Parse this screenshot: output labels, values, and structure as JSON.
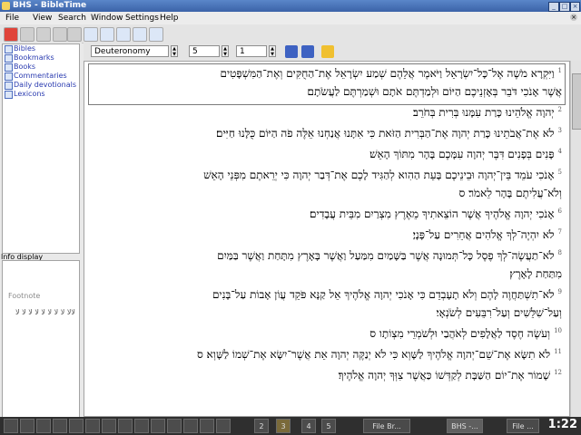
{
  "window": {
    "title": "BHS - BibleTime"
  },
  "menu": [
    "File",
    "View",
    "Search",
    "Window",
    "Settings",
    "Help"
  ],
  "modules": [
    "Bibles",
    "Bookmarks",
    "Books",
    "Commentaries",
    "Daily devotionals",
    "Lexicons"
  ],
  "info": {
    "heading": "Info display",
    "footnote": "Footnote"
  },
  "reader": {
    "book": "Deuteronomy",
    "chapter": "5",
    "verse": "1"
  },
  "verses": [
    {
      "n": "1",
      "lines": [
        "וַיִּקְרָא מֹשֶׁה אֶל־כָּל־יִשְׂרָאֵל וַיֹּאמֶר אֲלֵהֶם שְׁמַע יִשְׂרָאֵל אֶת־הַחֻקִּים וְאֶת־הַמִּשְׁפָּטִים",
        "אֲשֶׁר אָנֹכִי דֹּבֵר בְּאָזְנֵיכֶם הַיּוֹם וּלְמַדְתֶּם אֹתָם וּשְׁמַרְתֶּם לַעֲשֹׂתָם׃"
      ]
    },
    {
      "n": "2",
      "lines": [
        "יְהוָה אֱלֹהֵינוּ כָּרַת עִמָּנוּ בְּרִית בְּחֹרֵב׃"
      ]
    },
    {
      "n": "3",
      "lines": [
        "לֹא אֶת־אֲבֹתֵינוּ כָּרַת יְהוָה אֶת־הַבְּרִית הַזֹּאת כִּי אִתָּנוּ אֲנַחְנוּ אֵלֶּה פֹה הַיּוֹם כֻּלָּנוּ חַיִּים׃"
      ]
    },
    {
      "n": "4",
      "lines": [
        "פָּנִים בְּפָנִים דִּבֶּר יְהוָה עִמָּכֶם בָּהָר מִתּוֹךְ הָאֵשׁ׃"
      ]
    },
    {
      "n": "5",
      "lines": [
        "אָנֹכִי עֹמֵד בֵּין־יְהוָה וּבֵינֵיכֶם בָּעֵת הַהִוא לְהַגִּיד לָכֶם אֶת־דְּבַר יְהוָה כִּי יְרֵאתֶם מִפְּנֵי הָאֵשׁ",
        "וְלֹא־עֲלִיתֶם בָּהָר לֵאמֹר׃ ס"
      ]
    },
    {
      "n": "6",
      "lines": [
        "אָנֹכִי יְהוָה אֱלֹהֶיךָ אֲשֶׁר הוֹצֵאתִיךָ מֵאֶרֶץ מִצְרַיִם מִבֵּית עֲבָדִים׃"
      ]
    },
    {
      "n": "7",
      "lines": [
        "לֹא יִהְיֶה־לְךָ אֱלֹהִים אֲחֵרִים עַל־פָּנָיַ׃"
      ]
    },
    {
      "n": "8",
      "lines": [
        "לֹא־תַעֲשֶׂה־לְךָ פֶסֶל כָּל־תְּמוּנָה אֲשֶׁר בַּשָּׁמַיִם מִמַּעַל וַאֲשֶׁר בָּאָרֶץ מִתָּחַת וַאֲשֶׁר בַּמַּיִם",
        "מִתַּחַת לָאָרֶץ׃"
      ]
    },
    {
      "n": "9",
      "lines": [
        "לֹא־תִשְׁתַּחֲוֶה לָהֶם וְלֹא תָעָבְדֵם כִּי אָנֹכִי יְהוָה אֱלֹהֶיךָ אֵל קַנָּא פֹּקֵד עֲוֹן אָבוֹת עַל־בָּנִים",
        "וְעַל־שִׁלֵּשִׁים וְעַל־רִבֵּעִים לְשֹׂנְאָי׃"
      ]
    },
    {
      "n": "10",
      "lines": [
        "וְעֹשֶׂה חֶסֶד לַאֲלָפִים לְאֹהֲבַי וּלְשֹׁמְרֵי מִצְוֹתָו ס"
      ]
    },
    {
      "n": "11",
      "lines": [
        "לֹא תִשָּׂא אֶת־שֵׁם־יְהוָה אֱלֹהֶיךָ לַשָּׁוְא כִּי לֹא יְנַקֶּה יְהוָה אֵת אֲשֶׁר־יִשָּׂא אֶת־שְׁמוֹ לַשָּׁוְא׃ ס"
      ]
    },
    {
      "n": "12",
      "lines": [
        "שָׁמוֹר אֶת־יוֹם הַשַּׁבָּת לְקַדְּשׁוֹ כַּאֲשֶׁר צִוְּךָ יְהוָה אֱלֹהֶיךָ׃"
      ]
    }
  ],
  "taskbar": {
    "pages": [
      "2",
      "3",
      "4",
      "5"
    ],
    "tasks": [
      "File Br...",
      "BHS -...",
      "File ..."
    ],
    "clock": "1:22"
  }
}
